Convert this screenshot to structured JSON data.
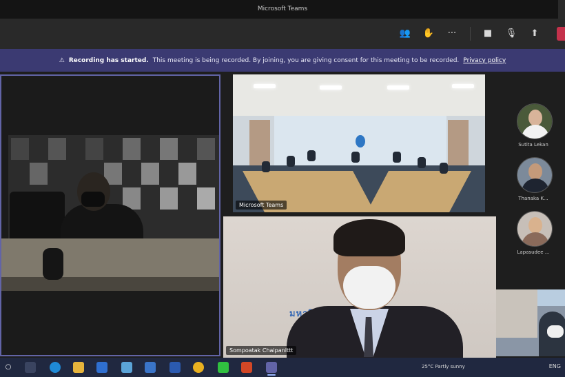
{
  "window": {
    "title": "Microsoft Teams"
  },
  "toolbar": {
    "icons": [
      "people-icon",
      "chat-icon",
      "more-icon",
      "camera-icon",
      "mic-off-icon",
      "share-icon",
      "leave-icon"
    ],
    "accent": "#c4314b"
  },
  "banner": {
    "title": "Recording has started.",
    "message": "This meeting is being recorded. By joining, you are giving consent for this meeting to be recorded.",
    "link": "Privacy policy",
    "color": "#3b3a72"
  },
  "tiles": {
    "room_label": "Microsoft Teams",
    "speaker_label": "Sompoatak Chaipanittt",
    "speaker_banner_text": "มหาวิท"
  },
  "roster": [
    {
      "name": "Sutita Lekan",
      "skin": "#d8b49a",
      "bg": "#4a5a3a",
      "shirt": "#f2f2f2"
    },
    {
      "name": "Thanaka K...",
      "skin": "#c49a7a",
      "bg": "#7c8a9a",
      "shirt": "#1e2430"
    },
    {
      "name": "Lapasudee ...",
      "skin": "#d9b28e",
      "bg": "#c7bfb8",
      "shirt": "#8a6a5a"
    }
  ],
  "taskbar": {
    "icons": [
      "start-icon",
      "search-icon",
      "taskview-icon",
      "edge-icon",
      "explorer-icon",
      "mail-icon",
      "store-icon",
      "word-icon",
      "chrome-icon",
      "line-icon",
      "powerpoint-icon",
      "teams-icon"
    ],
    "weather": "25°C  Partly sunny",
    "tray_time": "ENG"
  }
}
